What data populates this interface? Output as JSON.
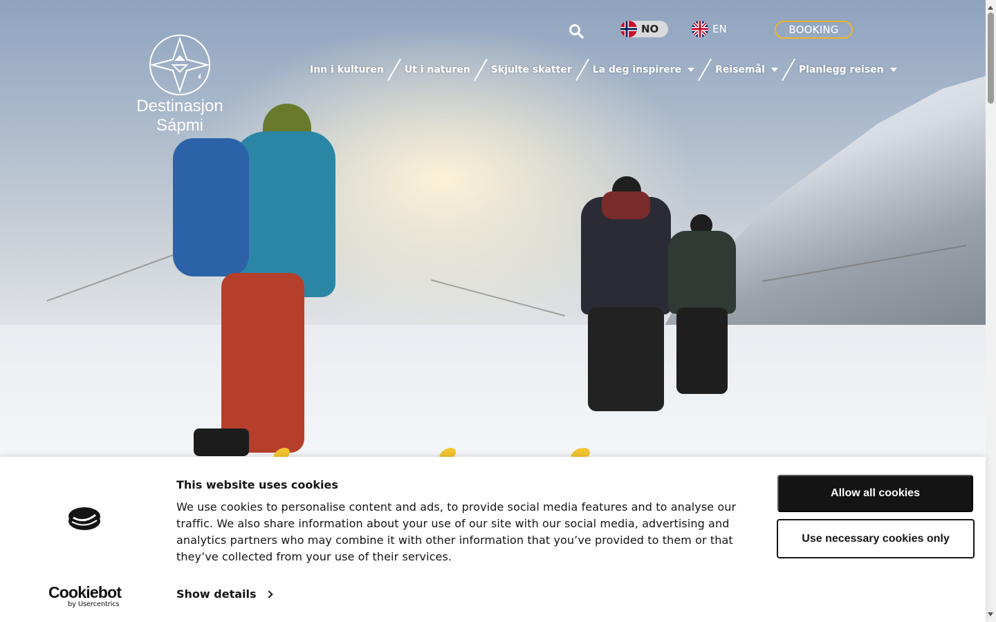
{
  "header": {
    "logo": {
      "line1": "Destinasjon",
      "line2": "Sápmi"
    },
    "languages": [
      {
        "code": "NO",
        "active": true
      },
      {
        "code": "EN",
        "active": false
      }
    ],
    "booking_label": "BOOKING"
  },
  "nav": {
    "items": [
      {
        "label": "Inn i kulturen",
        "has_dropdown": false
      },
      {
        "label": "Ut i naturen",
        "has_dropdown": false
      },
      {
        "label": "Skjulte skatter",
        "has_dropdown": false
      },
      {
        "label": "La deg inspirere",
        "has_dropdown": true
      },
      {
        "label": "Reisemål",
        "has_dropdown": true
      },
      {
        "label": "Planlegg reisen",
        "has_dropdown": true
      }
    ]
  },
  "cookie_banner": {
    "title": "This website uses cookies",
    "text": "We use cookies to personalise content and ads, to provide social media features and to analyse our traffic. We also share information about your use of our site with our social media, advertising and analytics partners who may combine it with other information that you’ve provided to them or that they’ve collected from your use of their services.",
    "show_details": "Show details",
    "allow_all": "Allow all cookies",
    "necessary_only": "Use necessary cookies only",
    "brand": {
      "name": "Cookiebot",
      "sub": "by Usercentrics"
    }
  },
  "colors": {
    "accent": "#f0b429",
    "dark": "#141414",
    "lang_active_bg": "#d9dadc"
  },
  "icons": [
    "search-icon",
    "norway-flag-icon",
    "uk-flag-icon",
    "chevron-down-icon",
    "chevron-right-icon",
    "cookiebot-icon"
  ]
}
